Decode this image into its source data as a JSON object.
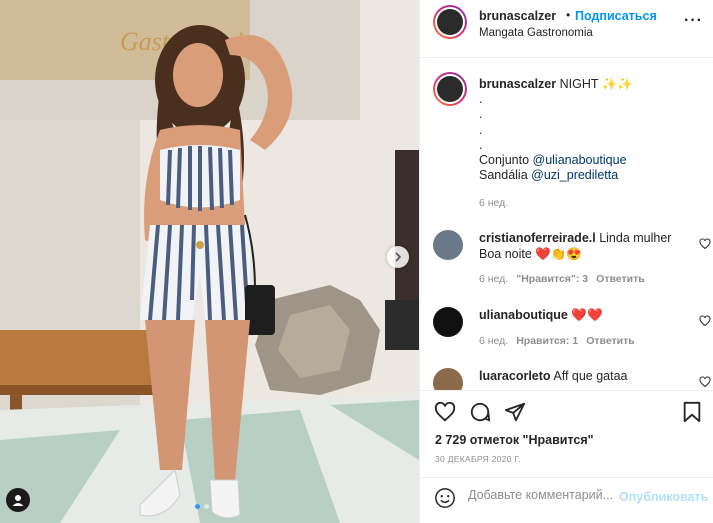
{
  "post": {
    "image_alt": "photo",
    "sign_text": "Gastronomia",
    "carousel_dots": 2,
    "active_dot": 0
  },
  "header": {
    "username": "brunascalzer",
    "separator": "•",
    "follow_label": "Подписаться",
    "location": "Mangata Gastronomia",
    "more_label": "···"
  },
  "caption": {
    "username": "brunascalzer",
    "text": "NIGHT ✨✨",
    "lines": [
      ".",
      ".",
      ".",
      "."
    ],
    "outfit_prefix": "Conjunto ",
    "outfit_mention": "@ulianaboutique",
    "sandal_prefix": "Sandália ",
    "sandal_mention": "@uzi_prediletta",
    "time": "6 нед."
  },
  "comments": [
    {
      "username": "cristianoferreirade.l",
      "text": "Linda mulher Boa noite ❤️👏😍",
      "time": "6 нед.",
      "likes": "\"Нравится\": 3",
      "reply": "Ответить",
      "avatar_color": "#6b7a8a"
    },
    {
      "username": "ulianaboutique",
      "text": "❤️❤️",
      "time": "6 нед.",
      "likes": "Нравится: 1",
      "reply": "Ответить",
      "avatar_color": "#111111"
    },
    {
      "username": "luaracorleto",
      "text": "Aff que gataa",
      "avatar_color": "#8a6a4a"
    }
  ],
  "actions": {
    "likes_text": "2 729 отметок \"Нравится\"",
    "date": "30 ДЕКАБРЯ 2020 Г."
  },
  "add_comment": {
    "placeholder": "Добавьте комментарий...",
    "publish_label": "Опубликовать"
  },
  "colors": {
    "accent": "#0095f6",
    "mention": "#00376b",
    "muted": "#8e8e8e",
    "publish_disabled": "#b2dffc"
  }
}
